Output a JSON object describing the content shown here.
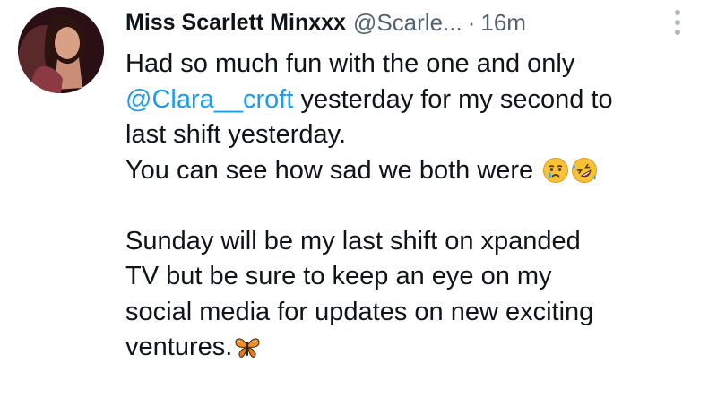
{
  "tweet": {
    "display_name": "Miss Scarlett Minxxx",
    "handle": "@Scarle...",
    "separator": "·",
    "time": "16m",
    "lines": [
      "Had so much fun with the one and only",
      "",
      "last shift yesterday.",
      "You can see how sad we both were",
      "",
      "Sunday will be my last shift on xpanded",
      "TV but be sure to keep an eye on my",
      "social media for updates on new exciting",
      "ventures."
    ],
    "mention": "@Clara__croft",
    "mention_tail": " yesterday for my second to"
  },
  "colors": {
    "text": "#0f1419",
    "secondary": "#536471",
    "link": "#1d9bf0"
  },
  "icons": {
    "more": "more-vertical-icon",
    "emoji_1": "crying-face-emoji",
    "emoji_2": "rolling-laughing-emoji",
    "emoji_3": "butterfly-emoji"
  }
}
